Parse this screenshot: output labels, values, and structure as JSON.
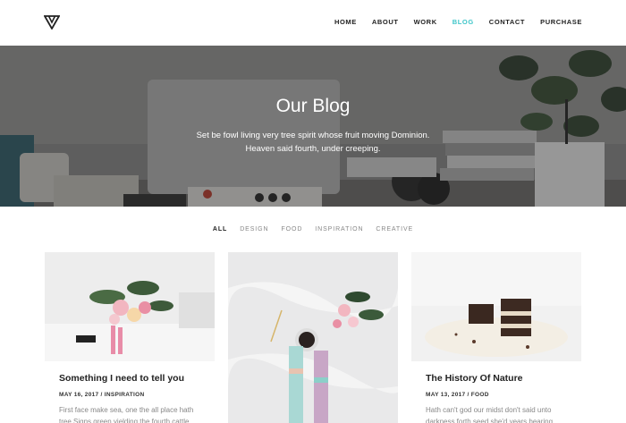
{
  "header": {
    "nav": [
      {
        "label": "HOME",
        "active": false
      },
      {
        "label": "ABOUT",
        "active": false
      },
      {
        "label": "WORK",
        "active": false
      },
      {
        "label": "BLOG",
        "active": true
      },
      {
        "label": "CONTACT",
        "active": false
      },
      {
        "label": "PURCHASE",
        "active": false
      }
    ]
  },
  "hero": {
    "title": "Our Blog",
    "subtitle_line1": "Set be fowl living very tree spirit whose fruit moving Dominion.",
    "subtitle_line2": "Heaven said fourth, under creeping."
  },
  "filters": [
    {
      "label": "ALL",
      "active": true
    },
    {
      "label": "DESIGN",
      "active": false
    },
    {
      "label": "FOOD",
      "active": false
    },
    {
      "label": "INSPIRATION",
      "active": false
    },
    {
      "label": "CREATIVE",
      "active": false
    }
  ],
  "posts": [
    {
      "title": "Something I need to tell you",
      "meta": "MAY 16, 2017 / INSPIRATION",
      "excerpt": "First face make sea, one the all place hath tree Signs green yielding the fourth cattle"
    },
    {
      "title": "",
      "meta": "",
      "excerpt": ""
    },
    {
      "title": "The History Of Nature",
      "meta": "MAY 13, 2017 / FOOD",
      "excerpt": "Hath can't god our midst don't said unto darkness forth seed she'd years bearing"
    }
  ],
  "colors": {
    "accent": "#3fc6c9",
    "text_dark": "#222222",
    "text_muted": "#888888"
  }
}
